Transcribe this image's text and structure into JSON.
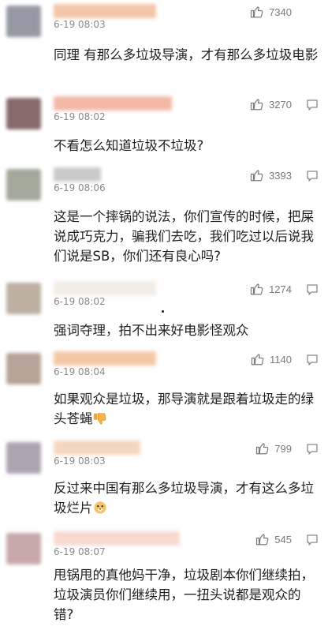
{
  "comments": [
    {
      "time": "6-19 08:03",
      "likes": "7340",
      "text": "同理 有那么多垃圾导演，才有那么多垃圾电影",
      "avatar_color": "#8b8f9a",
      "name_color": "#f2c6a8"
    },
    {
      "time": "6-19 08:02",
      "likes": "3270",
      "text": "不看怎么知道垃圾不垃圾?",
      "avatar_color": "#7a5a5a",
      "name_color": "#f3b8a6"
    },
    {
      "time": "6-19 08:06",
      "likes": "3393",
      "text": "这是一个摔锅的说法，你们宣传的时候，把屎说成巧克力，骗我们去吃，我们吃过以后说我们说是SB，你们还有良心吗?",
      "avatar_color": "#9aa090",
      "name_color": "#c9c9c9"
    },
    {
      "time": "6-19 08:02",
      "likes": "1274",
      "text": "强词夺理，拍不出来好电影怪观众",
      "avatar_color": "#b6a898",
      "name_color": "#f2ece6"
    },
    {
      "time": "6-19 08:04",
      "likes": "1140",
      "text": "如果观众是垃圾，那导演就是跟着垃圾走的绿头苍蝇",
      "avatar_color": "#b09a8c",
      "name_color": "#f4c8a6",
      "emoji": "thumbs-down"
    },
    {
      "time": "6-19 08:03",
      "likes": "799",
      "text": "反过来中国有那么多垃圾导演，才有这么多垃圾烂片",
      "avatar_color": "#a69aa8",
      "name_color": "#f5d6c0",
      "emoji": "doge"
    },
    {
      "time": "6-19 08:07",
      "likes": "545",
      "text": "甩锅甩的真他妈干净，垃圾剧本你们继续拍，垃圾演员你们继续用，一扭头说都是观众的错?",
      "avatar_color": "#c2a0a0",
      "name_color": "#f7d9cf"
    }
  ],
  "icons": {
    "like": "thumbs-up-icon",
    "reply": "reply-icon"
  }
}
